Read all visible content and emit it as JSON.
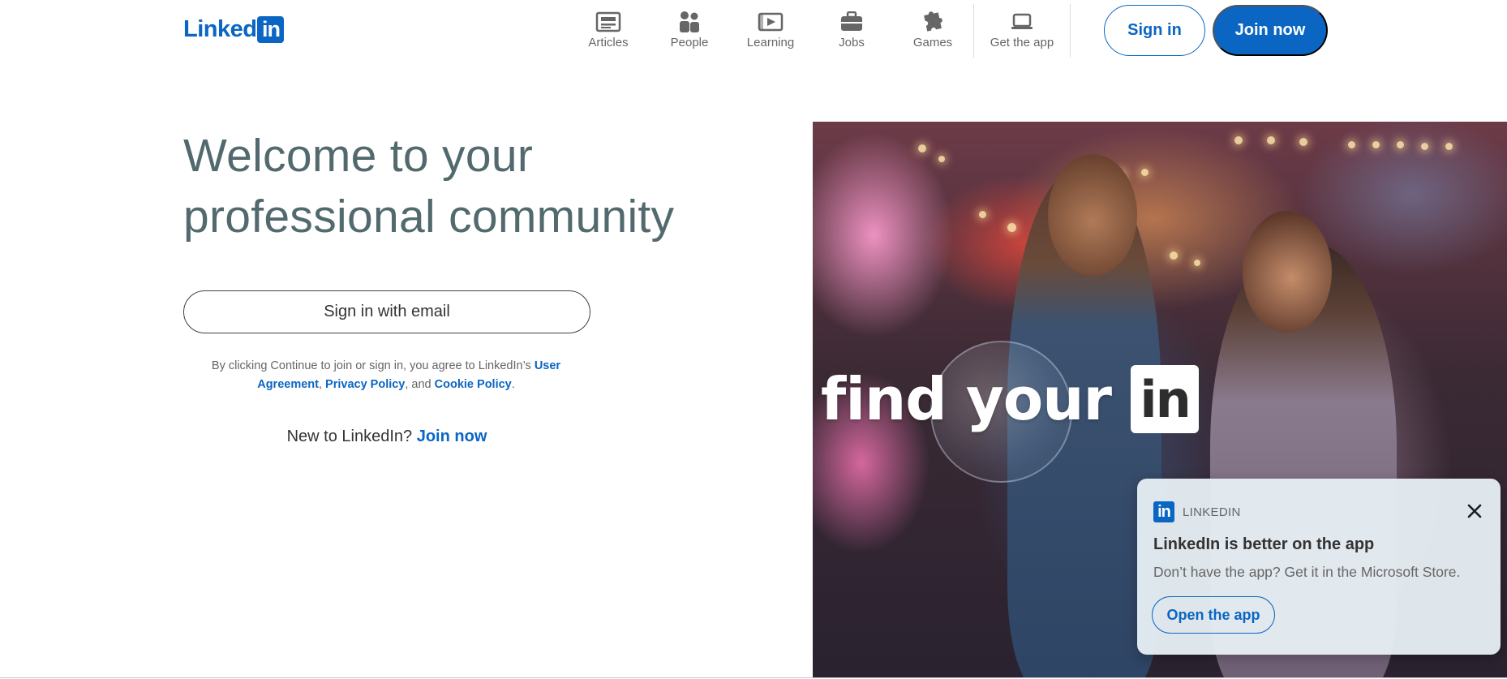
{
  "header": {
    "logo": {
      "word": "Linked",
      "box": "in"
    },
    "nav": [
      {
        "label": "Articles",
        "icon": "articles-icon"
      },
      {
        "label": "People",
        "icon": "people-icon"
      },
      {
        "label": "Learning",
        "icon": "learning-icon"
      },
      {
        "label": "Jobs",
        "icon": "jobs-icon"
      },
      {
        "label": "Games",
        "icon": "games-icon"
      },
      {
        "label": "Get the app",
        "icon": "laptop-icon"
      }
    ],
    "sign_in_label": "Sign in",
    "join_now_label": "Join now"
  },
  "hero": {
    "title_line1": "Welcome to your",
    "title_line2": "professional community",
    "email_button_label": "Sign in with email",
    "legal": {
      "prefix": "By clicking Continue to join or sign in, you agree to LinkedIn’s ",
      "user_agreement": "User Agreement",
      "comma": ", ",
      "privacy_policy": "Privacy Policy",
      "and": ", and ",
      "cookie_policy": "Cookie Policy",
      "suffix": "."
    },
    "new_to_text": "New to LinkedIn? ",
    "new_to_link": "Join now"
  },
  "hero_image": {
    "tagline": "find your",
    "tagline_box": "in"
  },
  "app_promo": {
    "brand": "LINKEDIN",
    "logo": "in",
    "title": "LinkedIn is better on the app",
    "subtitle": "Don’t have the app? Get it in the Microsoft Store.",
    "button_label": "Open the app",
    "close_icon": "close-icon"
  },
  "colors": {
    "brand_blue": "#0a66c2",
    "title_gray": "#526a6e",
    "nav_gray": "#666666"
  }
}
